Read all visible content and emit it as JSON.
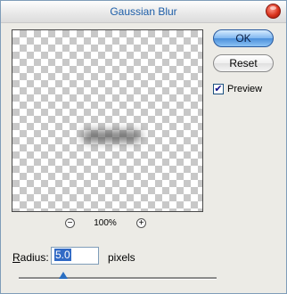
{
  "window": {
    "title": "Gaussian Blur"
  },
  "buttons": {
    "ok_label": "OK",
    "reset_label": "Reset"
  },
  "preview_toggle": {
    "label": "Preview",
    "checked": true,
    "checkmark": "✔"
  },
  "zoom": {
    "minus": "−",
    "level": "100%",
    "plus": "+"
  },
  "radius": {
    "label_first": "R",
    "label_rest": "adius:",
    "value": "5.0",
    "units": "pixels",
    "slider_level_fraction": 0.22
  },
  "colors": {
    "title_text": "#1d5ea8",
    "ok_accent": "#4b8fda",
    "close_red": "#d9321c",
    "slider_thumb": "#2b6fc2"
  }
}
